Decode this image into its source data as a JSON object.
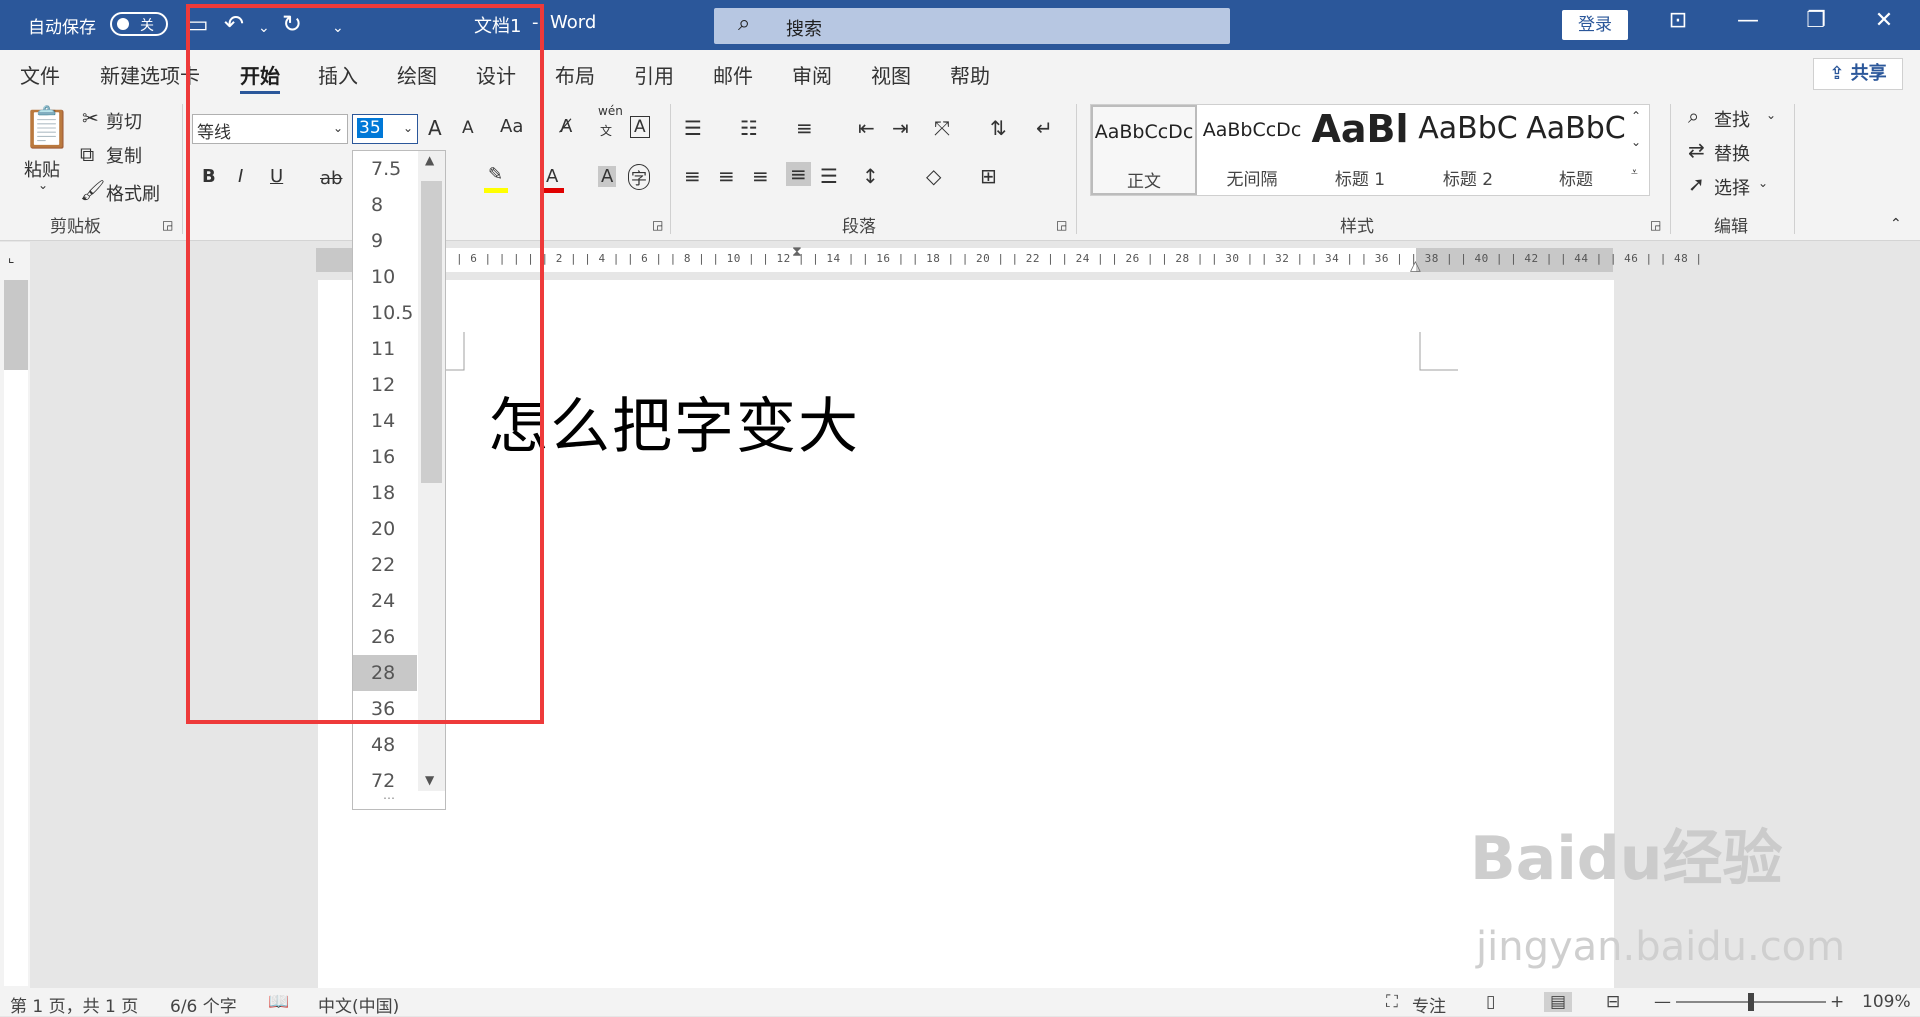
{
  "titlebar": {
    "autosave_label": "自动保存",
    "autosave_state": "关",
    "doc_title": "文档1",
    "separator": "-",
    "app_name": "Word",
    "search_placeholder": "搜索",
    "login_label": "登录"
  },
  "tabs": [
    "文件",
    "新建选项卡",
    "开始",
    "插入",
    "绘图",
    "设计",
    "布局",
    "引用",
    "邮件",
    "审阅",
    "视图",
    "帮助"
  ],
  "active_tab": "开始",
  "share_label": "共享",
  "clipboard": {
    "paste": "粘贴",
    "cut": "剪切",
    "copy": "复制",
    "format_painter": "格式刷",
    "group_label": "剪贴板"
  },
  "font": {
    "font_name": "等线",
    "font_size": "35",
    "bold": "B",
    "italic": "I",
    "underline": "U",
    "strike": "ab",
    "case": "Aa",
    "grow": "A",
    "shrink": "A",
    "phonetic": "wén",
    "phonetic_sub": "文",
    "char_border": "A",
    "shade": "A",
    "enclose": "字"
  },
  "paragraph": {
    "group_label": "段落"
  },
  "styles": {
    "group_label": "样式",
    "items": [
      {
        "preview": "AaBbCcDc",
        "name": "正文"
      },
      {
        "preview": "AaBbCcDc",
        "name": "无间隔"
      },
      {
        "preview": "AaBl",
        "name": "标题 1"
      },
      {
        "preview": "AaBbC",
        "name": "标题 2"
      },
      {
        "preview": "AaBbC",
        "name": "标题"
      }
    ]
  },
  "editing": {
    "find": "查找",
    "replace": "替换",
    "select": "选择",
    "group_label": "编辑"
  },
  "font_size_dropdown": {
    "options": [
      "7.5",
      "8",
      "9",
      "10",
      "10.5",
      "11",
      "12",
      "14",
      "16",
      "18",
      "20",
      "22",
      "24",
      "26",
      "28",
      "36",
      "48",
      "72"
    ],
    "highlighted": "28"
  },
  "ruler": {
    "numbers": "| 6 |    |    |   |  |  2  |  |  4  |  |  6  |  |  8  |  | 10 |  | 12 |  | 14 |  | 16 |  | 18 |  | 20 |  | 22 |  | 24 |  | 26 |  | 28 |  | 30 |  | 32 |  | 34 |  | 36 |  | 38 |  | 40 |  | 42 |  | 44 |  | 46 |  | 48 |"
  },
  "document": {
    "text": "怎么把字变大"
  },
  "statusbar": {
    "page": "第 1 页，共 1 页",
    "words": "6/6 个字",
    "language": "中文(中国)",
    "focus": "专注",
    "zoom": "109%"
  },
  "watermark": {
    "brand": "Baidu经验",
    "url": "jingyan.baidu.com"
  },
  "colors": {
    "accent": "#2b579a",
    "highlight_box": "#ee3a3a",
    "font_color": "#e00000",
    "highlighter": "#ffff00"
  }
}
